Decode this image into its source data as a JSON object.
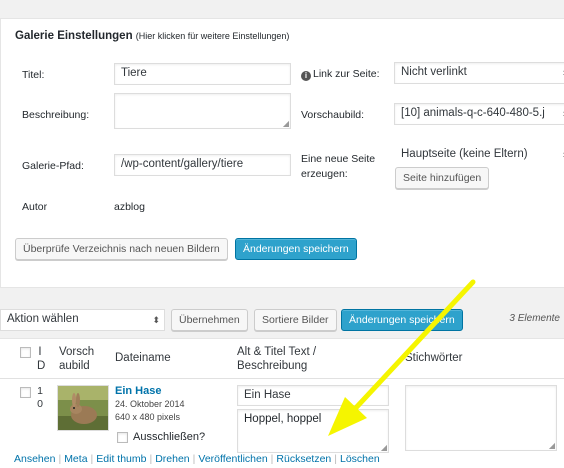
{
  "settings": {
    "title": "Galerie Einstellungen",
    "title_hint": "(Hier klicken für weitere Einstellungen)",
    "labels": {
      "title": "Titel:",
      "description": "Beschreibung:",
      "path": "Galerie-Pfad:",
      "author": "Autor",
      "link_page": "Link zur Seite:",
      "preview": "Vorschaubild:",
      "new_page": "Eine neue Seite erzeugen:"
    },
    "values": {
      "title": "Tiere",
      "description": "",
      "path": "/wp-content/gallery/tiere",
      "author": "azblog",
      "link_page": "Nicht verlinkt",
      "preview": "[10] animals-q-c-640-480-5.j",
      "new_page": "Hauptseite (keine Eltern)"
    },
    "buttons": {
      "add_page": "Seite hinzufügen",
      "scan": "Überprüfe Verzeichnis nach neuen Bildern",
      "save": "Änderungen speichern"
    }
  },
  "toolbar": {
    "bulk_action": "Aktion wählen",
    "apply": "Übernehmen",
    "sort": "Sortiere Bilder",
    "save": "Änderungen speichern",
    "count": "3 Elemente"
  },
  "table": {
    "headers": {
      "id_line1": "I",
      "id_line2": "D",
      "thumb_line1": "Vorsch",
      "thumb_line2": "aubild",
      "filename": "Dateiname",
      "alt_line1": "Alt & Titel Text /",
      "alt_line2": "Beschreibung",
      "tags": "Stichwörter"
    },
    "rows": [
      {
        "id_line1": "1",
        "id_line2": "0",
        "name": "Ein Hase",
        "date": "24. Oktober 2014",
        "size": "640 x 480 pixels",
        "exclude_label": "Ausschließen?",
        "alt": "Ein Hase",
        "description": "Hoppel, hoppel",
        "tags": "",
        "actions": {
          "view": "Ansehen",
          "meta": "Meta",
          "edit_thumb": "Edit thumb",
          "rotate": "Drehen",
          "publish": "Veröffentlichen",
          "reset": "Rücksetzen",
          "delete": "Löschen"
        }
      }
    ]
  },
  "colors": {
    "primary": "#2ea2cc",
    "link": "#0073aa",
    "arrow": "#f5f500"
  }
}
